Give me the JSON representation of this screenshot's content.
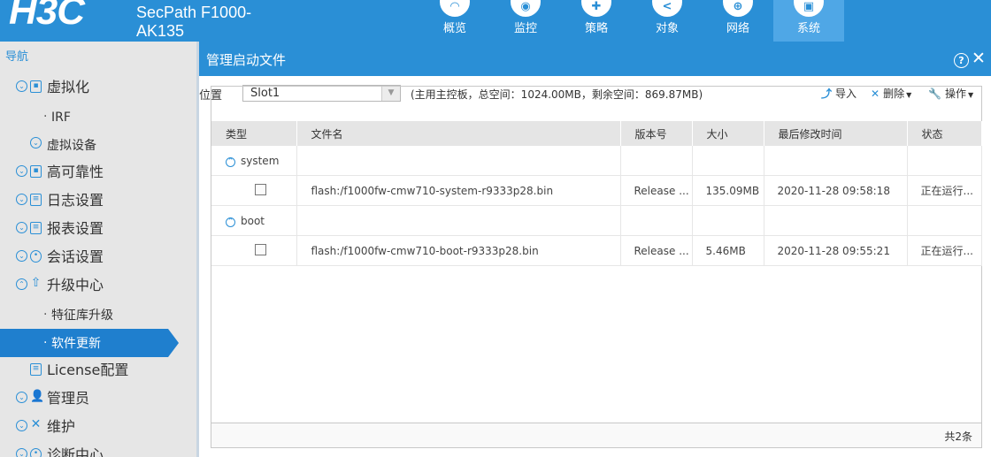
{
  "header": {
    "logo": "H3C",
    "product_line1": "SecPath F1000-",
    "product_line2": "AK135",
    "nav": [
      {
        "label": "概览",
        "icon": "dashboard-icon",
        "active": false
      },
      {
        "label": "监控",
        "icon": "camera-icon",
        "active": false
      },
      {
        "label": "策略",
        "icon": "shield-icon",
        "active": false
      },
      {
        "label": "对象",
        "icon": "share-icon",
        "active": false
      },
      {
        "label": "网络",
        "icon": "globe-icon",
        "active": false
      },
      {
        "label": "系统",
        "icon": "monitor-icon",
        "active": true
      }
    ]
  },
  "sidebar": {
    "title": "导航",
    "items": [
      {
        "label": "虚拟化",
        "level": 1
      },
      {
        "label": "IRF",
        "level": 2
      },
      {
        "label": "虚拟设备",
        "level": 2
      },
      {
        "label": "高可靠性",
        "level": 1
      },
      {
        "label": "日志设置",
        "level": 1
      },
      {
        "label": "报表设置",
        "level": 1
      },
      {
        "label": "会话设置",
        "level": 1
      },
      {
        "label": "升级中心",
        "level": 1
      },
      {
        "label": "特征库升级",
        "level": 2
      },
      {
        "label": "软件更新",
        "level": 2,
        "active": true
      },
      {
        "label": "License配置",
        "level": 1
      },
      {
        "label": "管理员",
        "level": 1
      },
      {
        "label": "维护",
        "level": 1
      },
      {
        "label": "诊断中心",
        "level": 1
      }
    ]
  },
  "panel": {
    "title": "管理启动文件",
    "location_label": "位置",
    "slot_value": "Slot1",
    "space_info": "(主用主控板，总空间：1024.00MB，剩余空间：869.87MB)",
    "import_label": "导入",
    "delete_label": "删除",
    "operate_label": "操作",
    "columns": [
      "类型",
      "文件名",
      "版本号",
      "大小",
      "最后修改时间",
      "状态"
    ],
    "groups": [
      {
        "name": "system",
        "files": [
          {
            "file": "flash:/f1000fw-cmw710-system-r9333p28.bin",
            "version": "Release ...",
            "size": "135.09MB",
            "modified": "2020-11-28 09:58:18",
            "status": "正在运行..."
          }
        ]
      },
      {
        "name": "boot",
        "files": [
          {
            "file": "flash:/f1000fw-cmw710-boot-r9333p28.bin",
            "version": "Release ...",
            "size": "5.46MB",
            "modified": "2020-11-28 09:55:21",
            "status": "正在运行..."
          }
        ]
      }
    ],
    "total": "共2条"
  },
  "colors": {
    "brand_blue": "#2a8fd6",
    "active_nav": "#4fa7e6",
    "sidebar_bg": "#e6e6e6",
    "sidebar_active": "#1f7fce"
  }
}
